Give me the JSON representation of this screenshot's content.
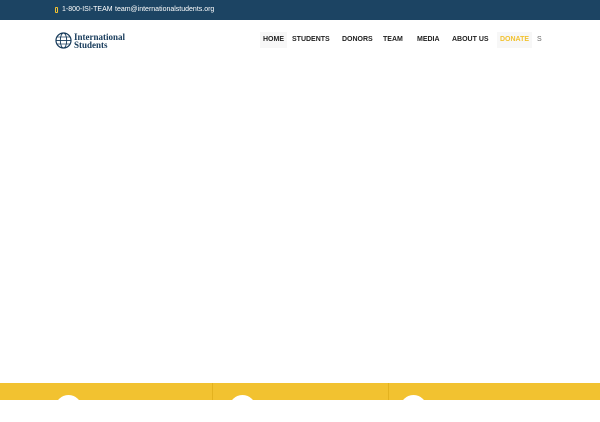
{
  "topbar": {
    "phone": "1-800-ISI-TEAM",
    "email": "team@internationalstudents.org"
  },
  "logo": {
    "line1": "International",
    "line2": "Students"
  },
  "nav": {
    "items": [
      "HOME",
      "STUDENTS",
      "DONORS",
      "TEAM",
      "MEDIA",
      "ABOUT US",
      "DONATE"
    ]
  },
  "colors": {
    "topbar": "#1c4463",
    "accent": "#f2c230",
    "nav_text": "#222222"
  },
  "icons": {
    "phone": "phone-icon",
    "search": "search-icon",
    "globe": "globe-icon"
  },
  "feature_strip": {
    "items": [
      "",
      "",
      ""
    ]
  }
}
